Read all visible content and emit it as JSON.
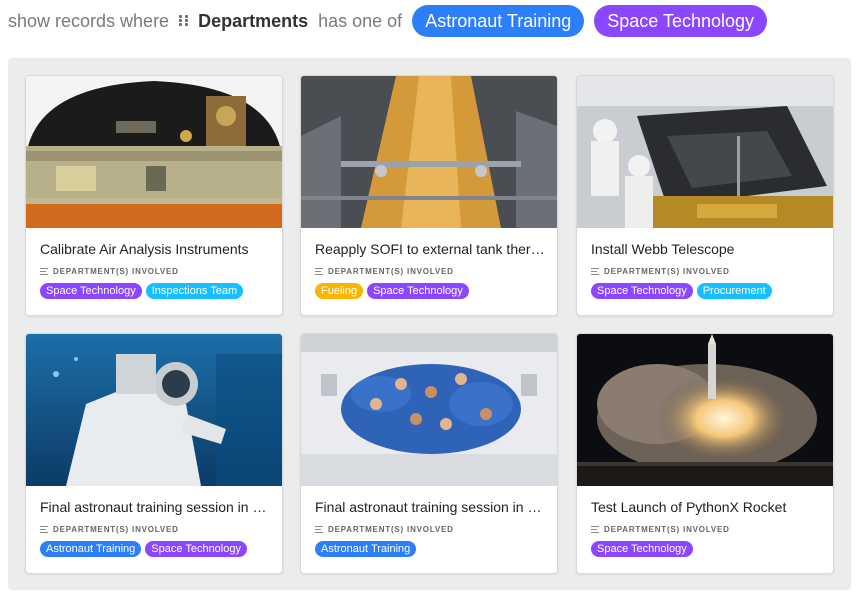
{
  "filter": {
    "prefix": "show records where",
    "field": "Departments",
    "operator": "has one of",
    "values": [
      {
        "label": "Astronaut Training",
        "color": "#2d7ff9"
      },
      {
        "label": "Space Technology",
        "color": "#8b46ff"
      }
    ]
  },
  "colors": {
    "Astronaut Training": "#2d7ff9",
    "Space Technology": "#8b46ff",
    "Inspections Team": "#18bfff",
    "Fueling": "#fcb400",
    "Procurement": "#18bfff"
  },
  "field_label": "DEPARTMENT(S) INVOLVED",
  "cards": [
    {
      "title": "Calibrate Air Analysis Instruments",
      "image": "instrument-panel-photo",
      "tags": [
        {
          "label": "Space Technology",
          "color": "#8b46ff"
        },
        {
          "label": "Inspections Team",
          "color": "#18bfff"
        }
      ]
    },
    {
      "title": "Reapply SOFI to external tank therm...",
      "image": "external-tank-photo",
      "tags": [
        {
          "label": "Fueling",
          "color": "#fcb400"
        },
        {
          "label": "Space Technology",
          "color": "#8b46ff"
        }
      ]
    },
    {
      "title": "Install Webb Telescope",
      "image": "webb-telescope-photo",
      "tags": [
        {
          "label": "Space Technology",
          "color": "#8b46ff"
        },
        {
          "label": "Procurement",
          "color": "#18bfff"
        }
      ]
    },
    {
      "title": "Final astronaut training session in ne...",
      "image": "underwater-astronaut-photo",
      "tags": [
        {
          "label": "Astronaut Training",
          "color": "#2d7ff9"
        },
        {
          "label": "Space Technology",
          "color": "#8b46ff"
        }
      ]
    },
    {
      "title": "Final astronaut training session in K...",
      "image": "zero-gravity-crew-photo",
      "tags": [
        {
          "label": "Astronaut Training",
          "color": "#2d7ff9"
        }
      ]
    },
    {
      "title": "Test Launch of PythonX Rocket",
      "image": "rocket-launch-photo",
      "tags": [
        {
          "label": "Space Technology",
          "color": "#8b46ff"
        }
      ]
    }
  ]
}
